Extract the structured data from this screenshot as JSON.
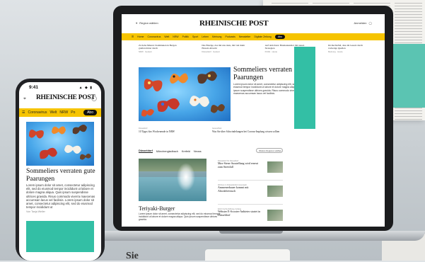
{
  "background": {
    "label": "Sie"
  },
  "desktop": {
    "region_label": "Region wählen",
    "user_label": "Anmelden",
    "logo": "RHEINISCHE POST",
    "nav": [
      "Home",
      "Coronavirus",
      "Welt",
      "NRW",
      "Politik",
      "Sport",
      "Leben",
      "Meinung",
      "Podcasts",
      "Newsletter",
      "Digitale Zeitung"
    ],
    "abo_label": "Abo",
    "teasers": [
      {
        "title": "Zu hohe Mieten: Kommunen in Bergen greifen härter durch",
        "meta": "NRW · Gestern"
      },
      {
        "title": "Das Einzige, das mit uns dazu, mit viel mehr Einsatz Abwehr",
        "meta": "Düsseldorf · Gestern"
      },
      {
        "title": "Auf dem Kurs: Bundeskanzler mit neuen Strategien",
        "meta": "Politik · Heute"
      },
      {
        "title": "Im Rechtsfall, dass im Gesetz durch vorherige Quellen",
        "meta": "Meinung · Heute"
      }
    ],
    "hero_title": "Sommeliers verraten gute Paarungen",
    "hero_body": "Lorem ipsum dolor sit amet, consectetur adipiscing elit, sed do eiusmod tempor incididunt ut labore et dolore magna aliqua. Quis ipsum suspendisse ultrices gravida. Risus commodo viverra maecenas accumsan lacus vel facilisis.",
    "small_teasers": [
      {
        "kicker": "Düsseldorf",
        "title": "10 Tipps fürs Wochenende in NRW"
      },
      {
        "kicker": "Gesundheit",
        "title": "Was Sie über Schwindelungen bei Corona-Impfung wissen sollten"
      }
    ],
    "tabs": [
      "Düsseldorf",
      "Mönchengladbach",
      "Krefeld",
      "Neuss"
    ],
    "select_label": "Weitere Regionen wählen",
    "feature_title": "Teriyaki-Burger",
    "feature_body": "Lorem ipsum dolor sit amet, consectetur adipiscing elit, sed do eiusmod tempor incididunt ut labore et dolore magna aliqua. Quis ipsum suspendisse ultrices gravida.",
    "list": [
      {
        "kicker": "Düsseldorf für Düsseldorf",
        "title": "Max-Stern-Ausstellung wird erneut zum Streitfall"
      },
      {
        "kicker": "Wohnen in Düsseldorfer Innenstadt",
        "title": "Ammenerbauer kommt mit Abwahlversuch"
      },
      {
        "kicker": "Erich Fuchs-Stiftung: Anfang",
        "title": "Webster E-Scooter-Anbieter startet in Düsseldorf"
      }
    ]
  },
  "phone": {
    "time": "9:41",
    "status": "▲ ◆ ▮",
    "logo": "RHEINISCHE POST",
    "nav": [
      "Coronavirus",
      "Welt",
      "NRW",
      "Po"
    ],
    "abo_label": "Abo",
    "title": "Sommeliers verraten gute Paarungen",
    "body": "Lorem ipsum dolor sit amet, consectetur adipiscing elit, sed do eiusmod tempor incididunt ut labore et dolore magna aliqua. Quis ipsum suspendisse ultrices gravida. Risus commodo viverra maecenas accumsan lacus vel facilisis. Lorem ipsum dolor sit amet, consectetur adipiscing elit, sed do eiusmod tempor incididunt ut",
    "author": "Von Tanja Weller"
  },
  "colors": {
    "brand_yellow": "#f6c400",
    "mint": "#33bfa5",
    "sky": "#48a6e8"
  }
}
